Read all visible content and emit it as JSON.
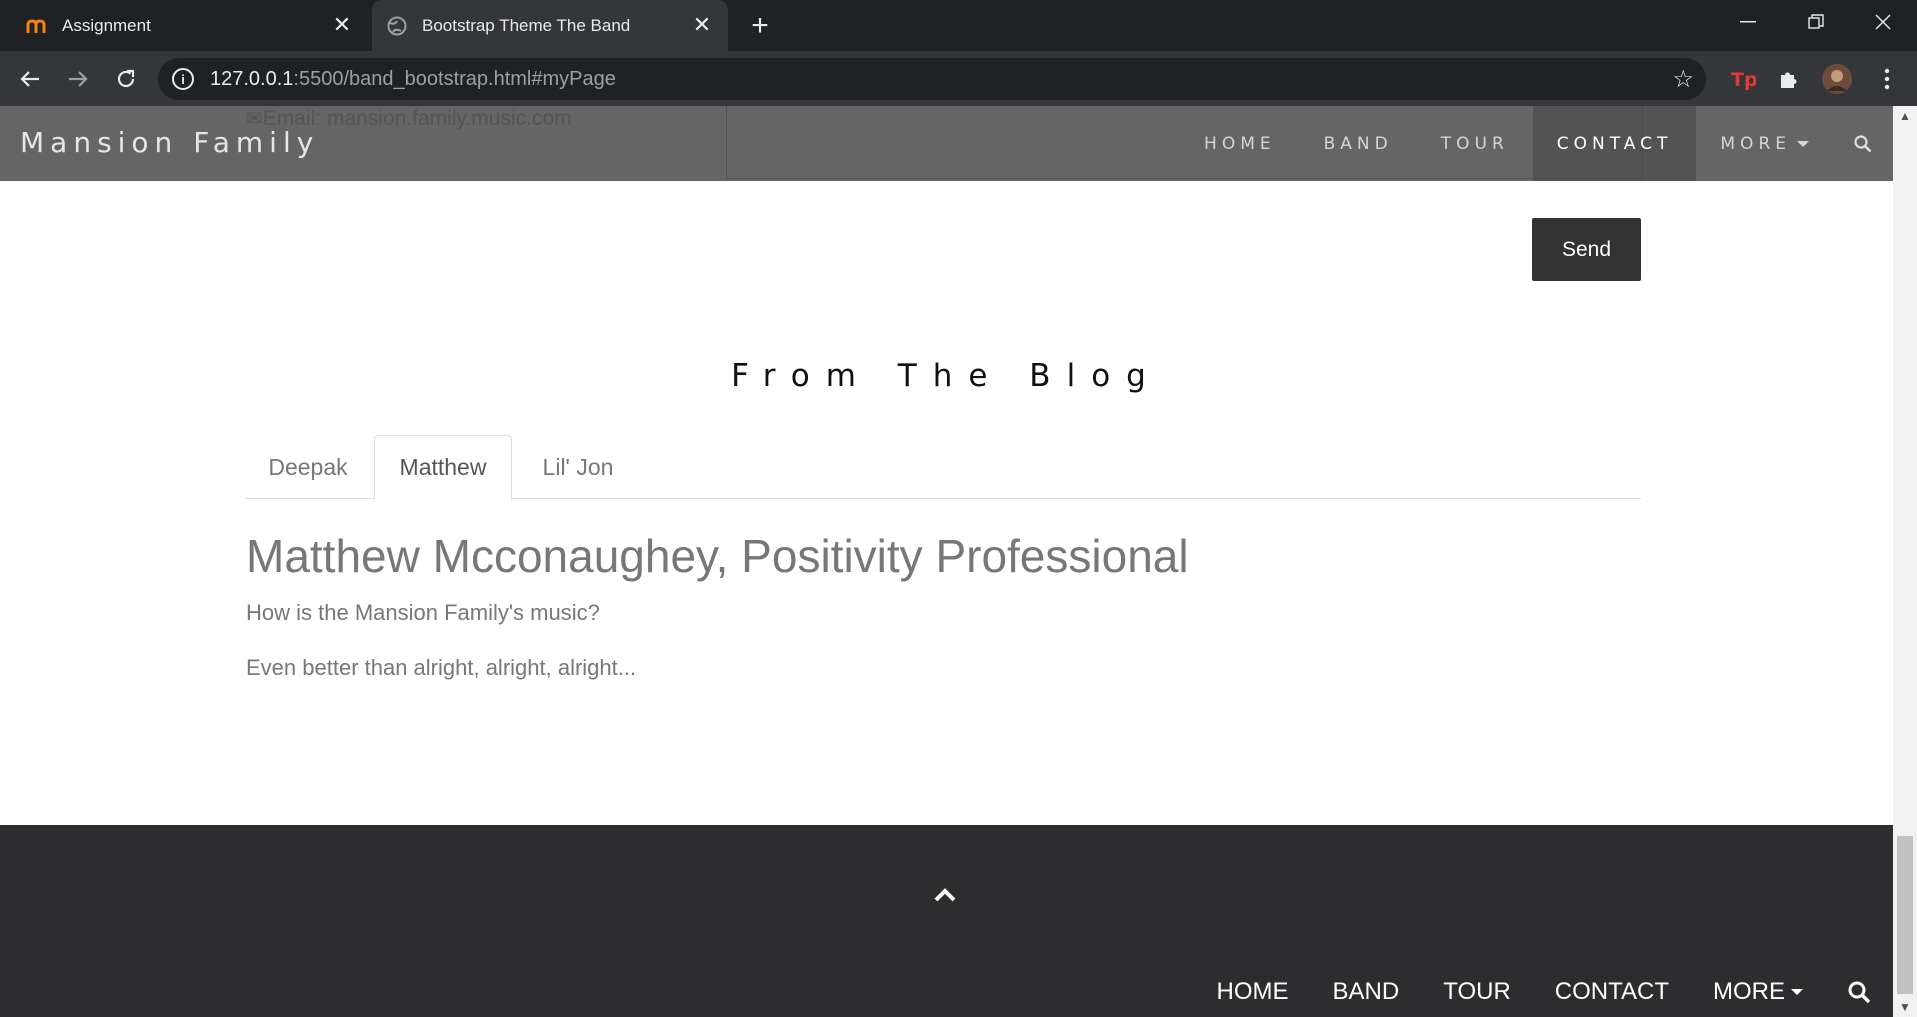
{
  "browser": {
    "tabs": [
      {
        "title": "Assignment",
        "favicon": "moodle-icon",
        "active": false
      },
      {
        "title": "Bootstrap Theme The Band",
        "favicon": "globe-icon",
        "active": true
      }
    ],
    "url_host": "127.0.0.1",
    "url_rest": ":5500/band_bootstrap.html#myPage"
  },
  "site": {
    "brand": "Mansion Family",
    "nav": [
      {
        "label": "HOME"
      },
      {
        "label": "BAND"
      },
      {
        "label": "TOUR"
      },
      {
        "label": "CONTACT"
      },
      {
        "label": "MORE"
      }
    ],
    "email_overflow": "Email: mansion.family.music.com",
    "send_label": "Send"
  },
  "blog": {
    "title": "From The Blog",
    "tabs": [
      {
        "label": "Deepak"
      },
      {
        "label": "Matthew"
      },
      {
        "label": "Lil' Jon"
      }
    ],
    "active_tab": "Matthew",
    "heading": "Matthew Mcconaughey, Positivity Professional",
    "question": "How is the Mansion Family's music?",
    "answer": "Even better than alright, alright, alright..."
  },
  "footer": {
    "nav": [
      {
        "label": "HOME"
      },
      {
        "label": "BAND"
      },
      {
        "label": "TOUR"
      },
      {
        "label": "CONTACT"
      },
      {
        "label": "MORE"
      }
    ]
  },
  "colors": {
    "chrome_dark": "#202124",
    "chrome_toolbar": "#35363a",
    "navbar": "#505050",
    "footer": "#2d2d30",
    "send_button": "#333333"
  }
}
